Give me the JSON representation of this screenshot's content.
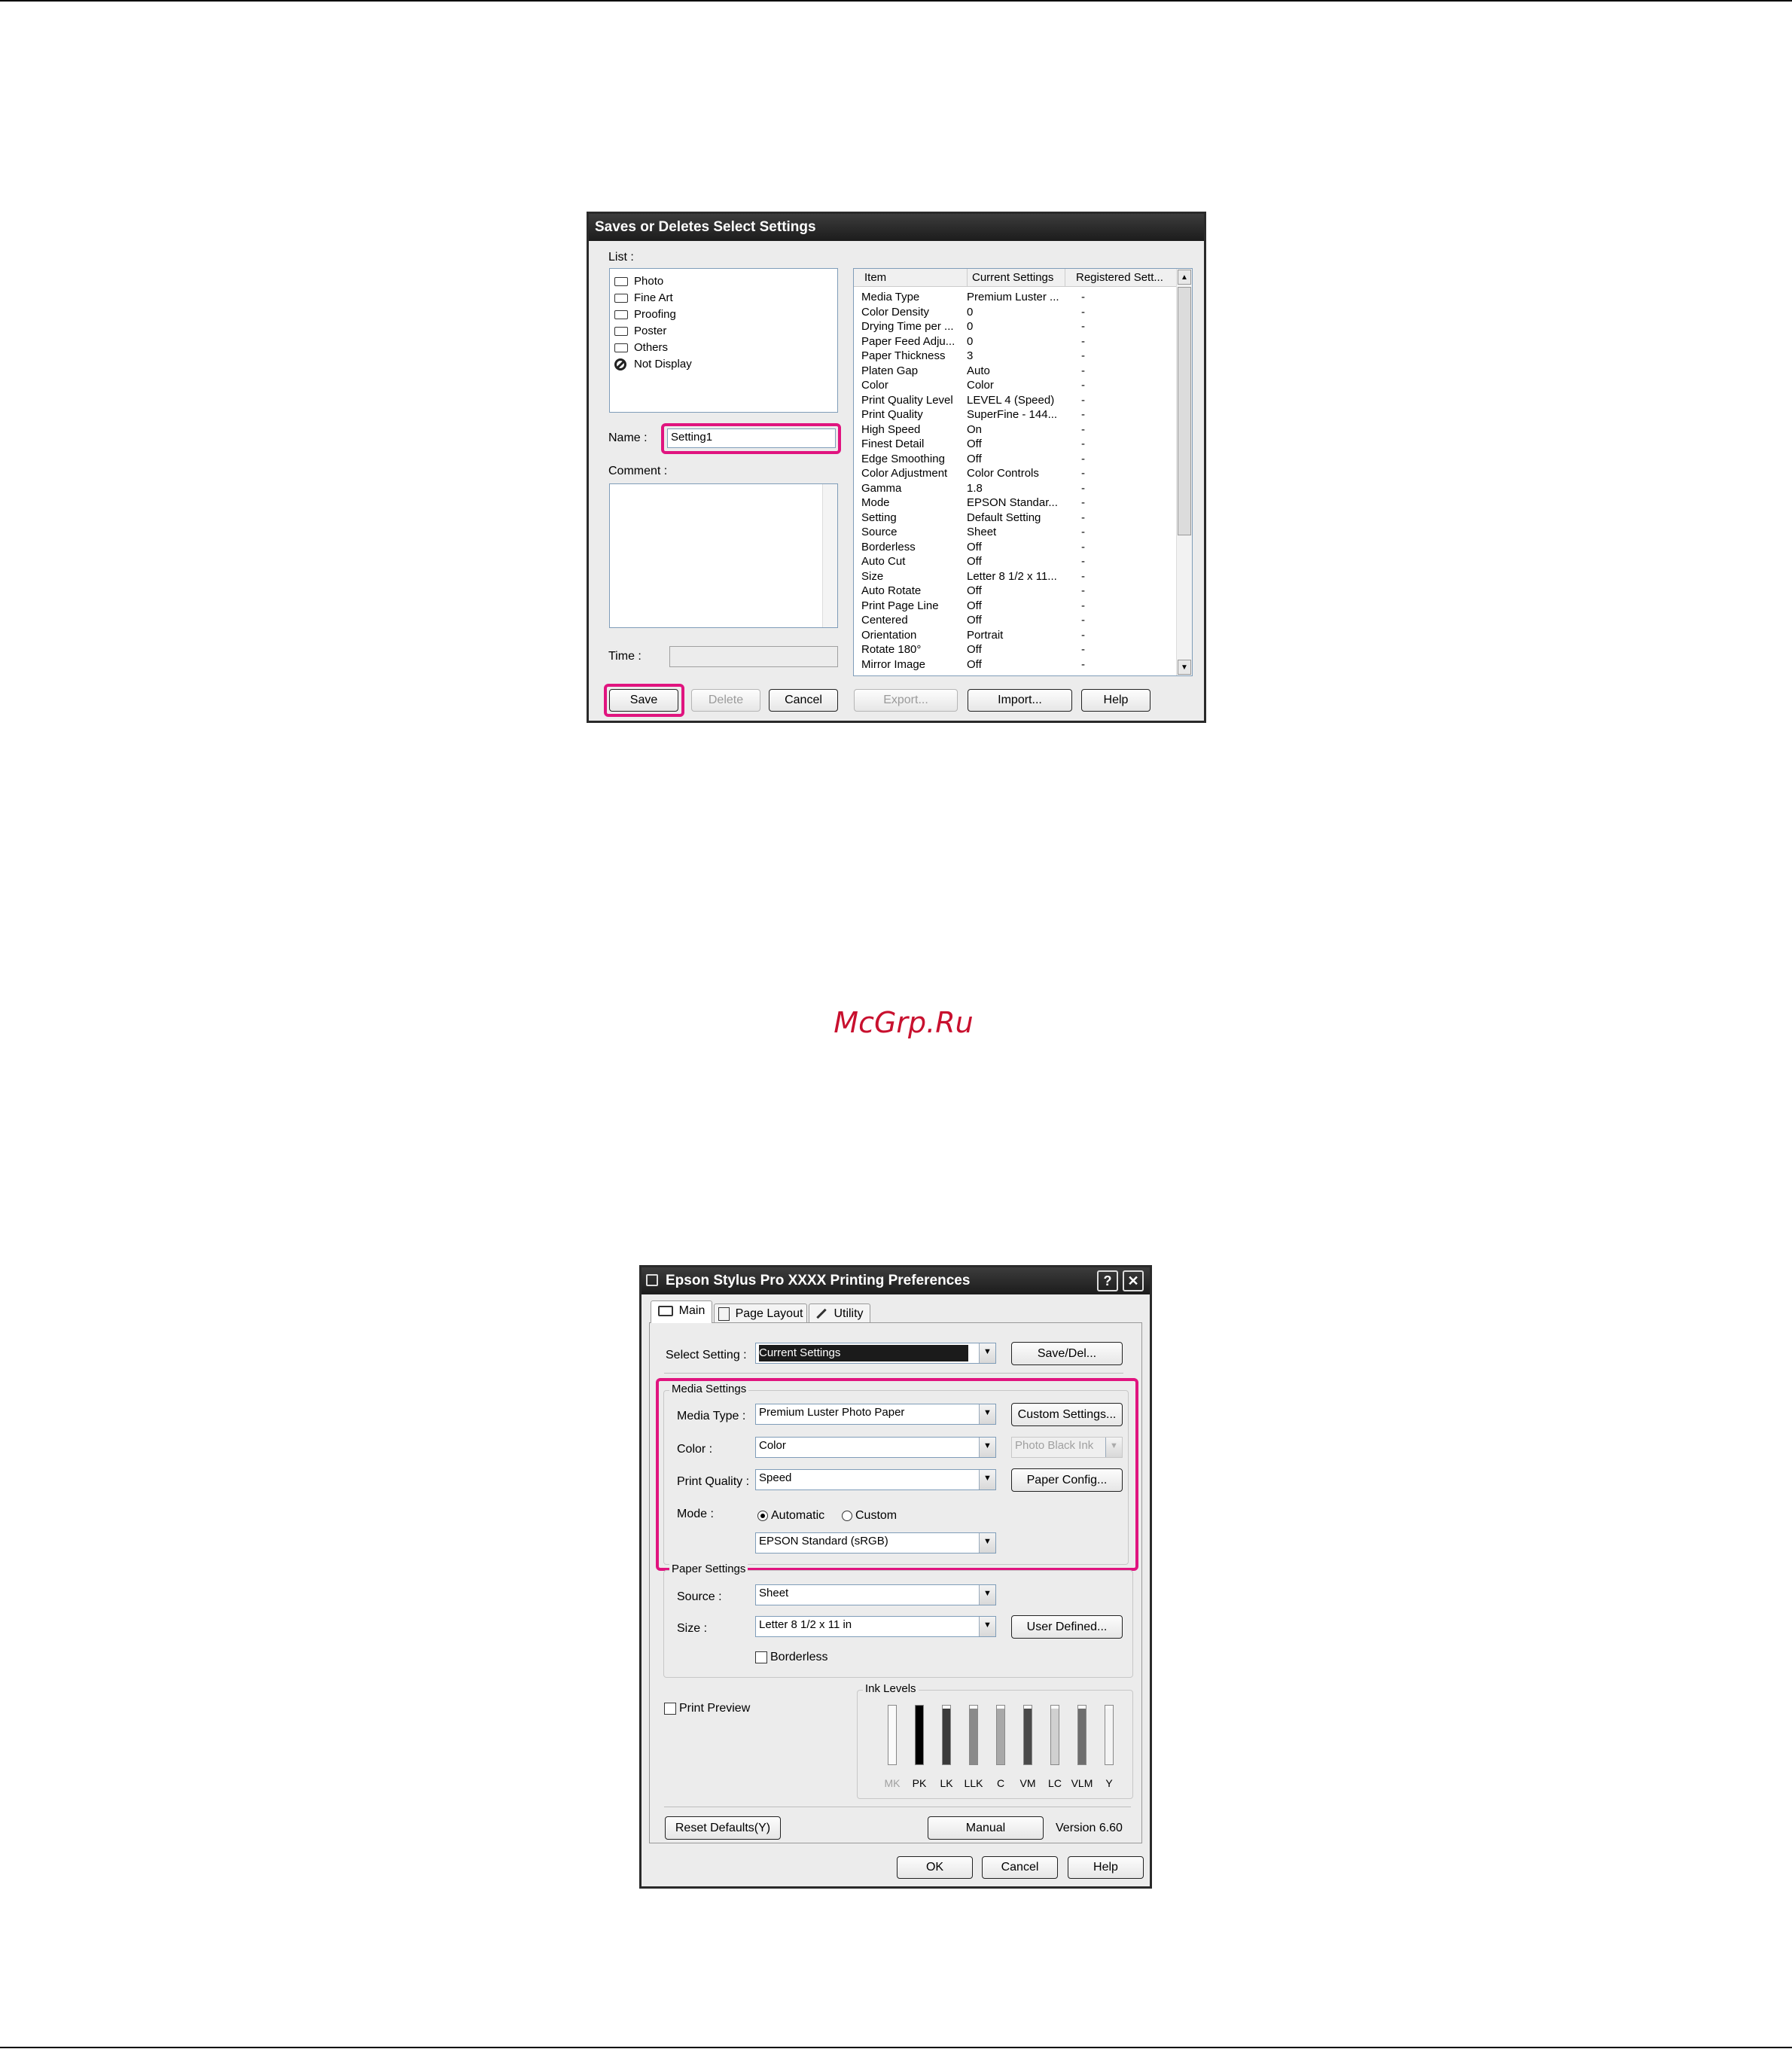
{
  "watermark": "McGrp.Ru",
  "dialog1": {
    "title": "Saves or Deletes Select Settings",
    "list_label": "List :",
    "list_items": [
      {
        "label": "Photo",
        "icon": "folder-icon"
      },
      {
        "label": "Fine Art",
        "icon": "folder-icon"
      },
      {
        "label": "Proofing",
        "icon": "folder-icon"
      },
      {
        "label": "Poster",
        "icon": "folder-icon"
      },
      {
        "label": "Others",
        "icon": "folder-icon"
      },
      {
        "label": "Not Display",
        "icon": "no-entry-icon"
      }
    ],
    "name_label": "Name :",
    "name_value": "Setting1",
    "comment_label": "Comment :",
    "time_label": "Time :",
    "buttons": {
      "save": "Save",
      "delete": "Delete",
      "cancel": "Cancel",
      "export": "Export...",
      "import": "Import...",
      "help": "Help"
    },
    "table_headers": [
      "Item",
      "Current Settings",
      "Registered Sett..."
    ],
    "table_rows": [
      [
        "Media Type",
        "Premium Luster ...",
        "-"
      ],
      [
        "Color Density",
        "0",
        "-"
      ],
      [
        "Drying Time per ...",
        "0",
        "-"
      ],
      [
        "Paper Feed Adju...",
        "0",
        "-"
      ],
      [
        "Paper Thickness",
        "3",
        "-"
      ],
      [
        "Platen Gap",
        "Auto",
        "-"
      ],
      [
        "Color",
        "Color",
        "-"
      ],
      [
        "Print Quality Level",
        "LEVEL 4 (Speed)",
        "-"
      ],
      [
        "Print Quality",
        "SuperFine - 144...",
        "-"
      ],
      [
        "High Speed",
        "On",
        "-"
      ],
      [
        "Finest Detail",
        "Off",
        "-"
      ],
      [
        "Edge Smoothing",
        "Off",
        "-"
      ],
      [
        "Color Adjustment",
        "Color Controls",
        "-"
      ],
      [
        "Gamma",
        "1.8",
        "-"
      ],
      [
        "Mode",
        "EPSON Standar...",
        "-"
      ],
      [
        "Setting",
        "Default Setting",
        "-"
      ],
      [
        "Source",
        "Sheet",
        "-"
      ],
      [
        "Borderless",
        "Off",
        "-"
      ],
      [
        "Auto Cut",
        "Off",
        "-"
      ],
      [
        "Size",
        "Letter 8 1/2 x 11...",
        "-"
      ],
      [
        "Auto Rotate",
        "Off",
        "-"
      ],
      [
        "Print Page Line",
        "Off",
        "-"
      ],
      [
        "Centered",
        "Off",
        "-"
      ],
      [
        "Orientation",
        "Portrait",
        "-"
      ],
      [
        "Rotate 180°",
        "Off",
        "-"
      ],
      [
        "Mirror Image",
        "Off",
        "-"
      ]
    ]
  },
  "dialog2": {
    "title": "Epson Stylus Pro XXXX Printing Preferences",
    "title_buttons": {
      "help": "?",
      "close": "✕"
    },
    "tabs": [
      "Main",
      "Page Layout",
      "Utility"
    ],
    "select_setting_label": "Select Setting :",
    "select_setting_value": "Current Settings",
    "save_del_button": "Save/Del...",
    "media_settings_title": "Media Settings",
    "media_type_label": "Media Type :",
    "media_type_value": "Premium Luster Photo Paper",
    "custom_settings_button": "Custom Settings...",
    "color_label": "Color :",
    "color_value": "Color",
    "black_ink_value": "Photo Black Ink",
    "print_quality_label": "Print Quality :",
    "print_quality_value": "Speed",
    "paper_config_button": "Paper Config...",
    "mode_label": "Mode :",
    "mode_automatic": "Automatic",
    "mode_custom": "Custom",
    "mode_selected": "Automatic",
    "mode_value": "EPSON Standard (sRGB)",
    "paper_settings_title": "Paper Settings",
    "source_label": "Source :",
    "source_value": "Sheet",
    "size_label": "Size :",
    "size_value": "Letter 8 1/2 x 11 in",
    "user_defined_button": "User Defined...",
    "borderless_label": "Borderless",
    "print_preview_label": "Print Preview",
    "ink_levels_title": "Ink Levels",
    "inks": [
      {
        "name": "MK",
        "level": 0.0,
        "color": "#bdbdbd",
        "disabled": true
      },
      {
        "name": "PK",
        "level": 1.0,
        "color": "#000000"
      },
      {
        "name": "LK",
        "level": 0.95,
        "color": "#3a3a3a"
      },
      {
        "name": "LLK",
        "level": 0.95,
        "color": "#8a8a8a"
      },
      {
        "name": "C",
        "level": 0.95,
        "color": "#a8a8a8"
      },
      {
        "name": "VM",
        "level": 0.95,
        "color": "#4a4a4a"
      },
      {
        "name": "LC",
        "level": 0.95,
        "color": "#d0d0d0"
      },
      {
        "name": "VLM",
        "level": 0.95,
        "color": "#6e6e6e"
      },
      {
        "name": "Y",
        "level": 0.95,
        "color": "#f4f4f4"
      }
    ],
    "reset_defaults_button": "Reset Defaults(Y)",
    "manual_button": "Manual",
    "version": "Version 6.60",
    "ok_button": "OK",
    "cancel_button": "Cancel",
    "help_button": "Help"
  },
  "colors": {
    "highlight": "#e0147f",
    "watermark": "#c8102e"
  }
}
